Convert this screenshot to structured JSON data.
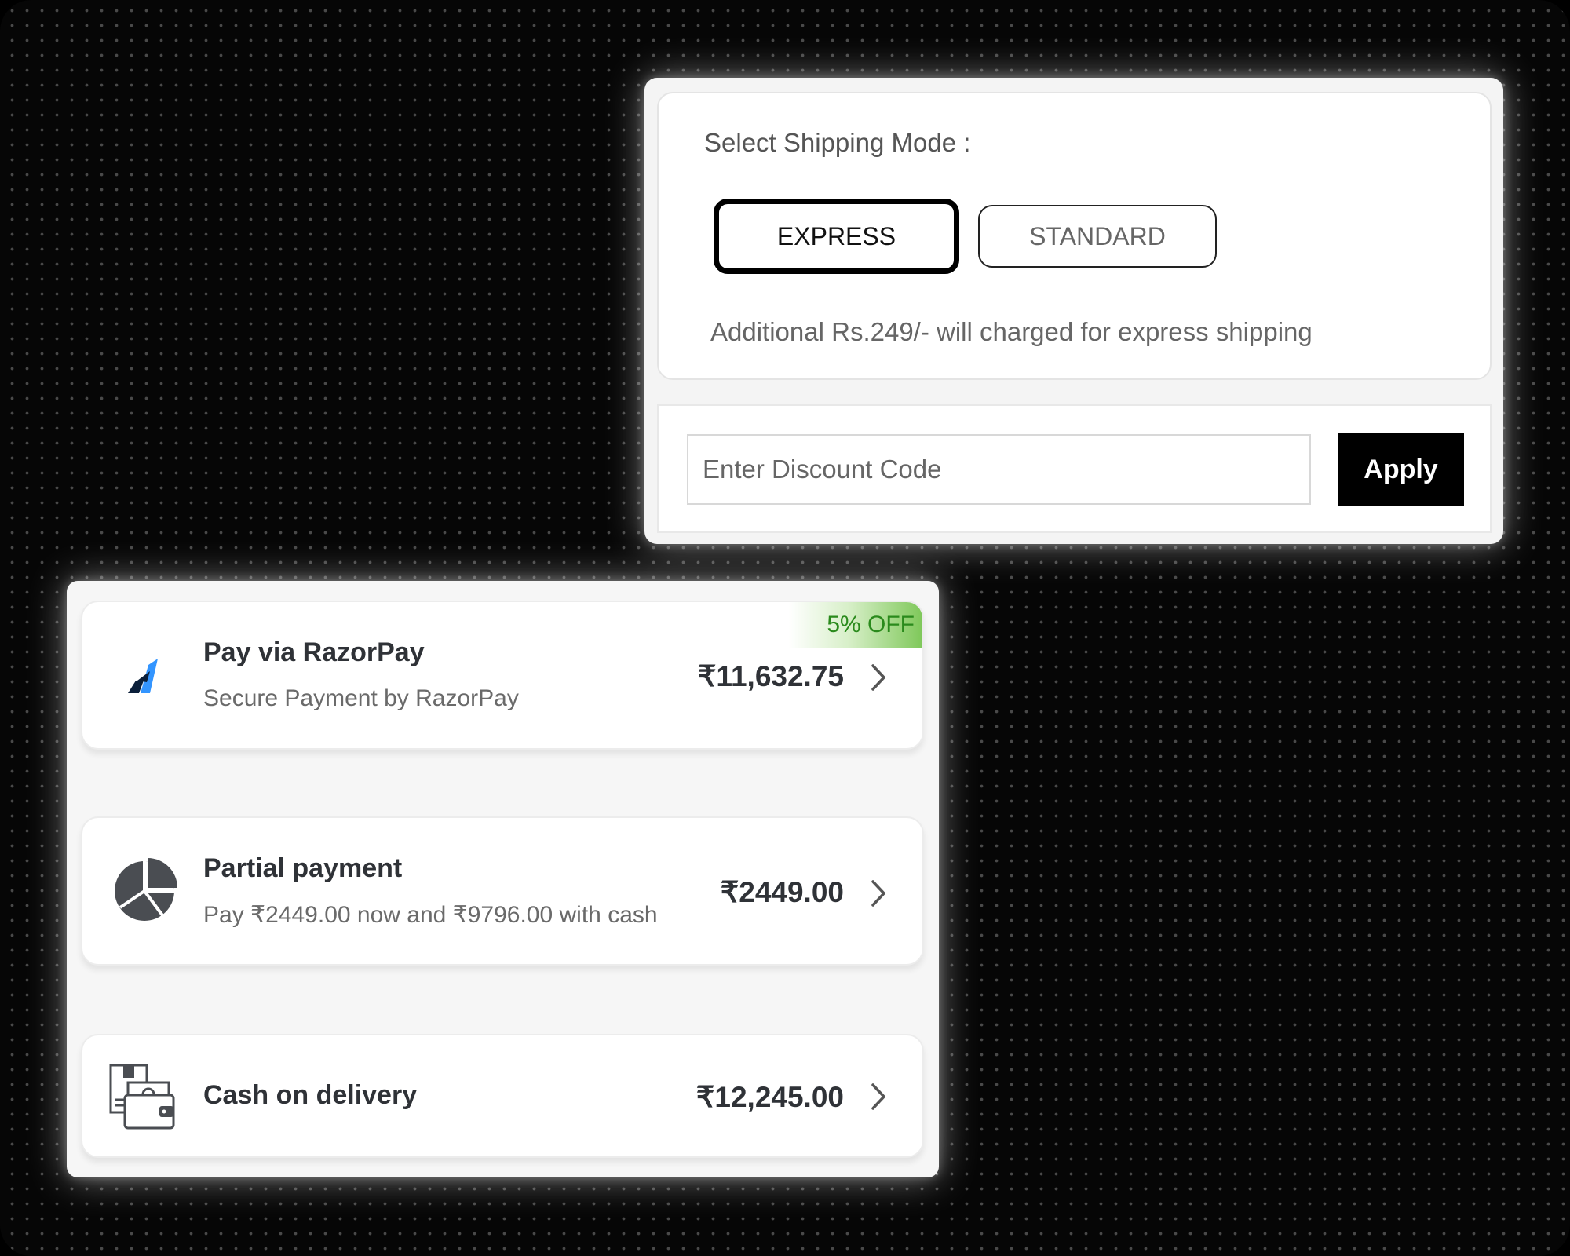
{
  "shipping": {
    "title": "Select Shipping Mode :",
    "modes": [
      {
        "label": "EXPRESS",
        "selected": true
      },
      {
        "label": "STANDARD",
        "selected": false
      }
    ],
    "note": "Additional Rs.249/- will charged for express shipping"
  },
  "discount": {
    "placeholder": "Enter Discount Code",
    "value": "",
    "apply_label": "Apply"
  },
  "payment_options": [
    {
      "icon": "razorpay-logo-icon",
      "title": "Pay via RazorPay",
      "subtitle": "Secure Payment by RazorPay",
      "amount": "₹11,632.75",
      "badge": "5% OFF"
    },
    {
      "icon": "pie-chart-icon",
      "title": "Partial payment",
      "subtitle": "Pay ₹2449.00 now and ₹9796.00 with cash",
      "amount": "₹2449.00"
    },
    {
      "icon": "cash-wallet-icon",
      "title": "Cash on delivery",
      "amount": "₹12,245.00"
    }
  ],
  "colors": {
    "accent": "#000000",
    "badge_text": "#2a8a1c",
    "badge_green": "#7fc85a",
    "razorpay_blue": "#3395ff",
    "icon_dark": "#2f3237"
  }
}
